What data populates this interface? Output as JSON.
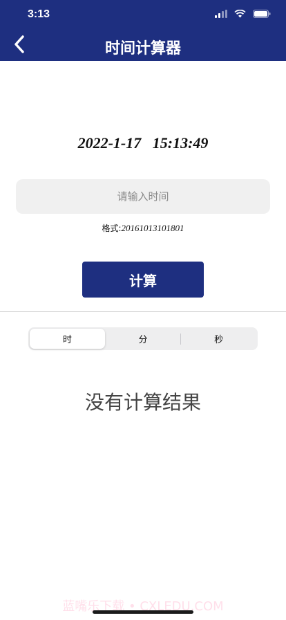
{
  "status_bar": {
    "time": "3:13"
  },
  "nav": {
    "title": "时间计算器",
    "back_icon": "chevron-left-icon"
  },
  "current_datetime": "2022-1-17   15:13:49",
  "time_input": {
    "value": "",
    "placeholder": "请输入时间"
  },
  "format_hint": {
    "label": "格式:",
    "value": "20161013101801"
  },
  "calculate_button": {
    "label": "计算"
  },
  "unit_tabs": {
    "selected": "时",
    "items": [
      {
        "label": "时"
      },
      {
        "label": "分"
      },
      {
        "label": "秒"
      }
    ]
  },
  "result": {
    "empty_text": "没有计算结果"
  },
  "watermark": "蓝嘴乐下载 • CXLEDU.COM",
  "colors": {
    "primary": "#1e2f80",
    "input_bg": "#f0f0f0",
    "segment_bg": "#eeeeef"
  }
}
